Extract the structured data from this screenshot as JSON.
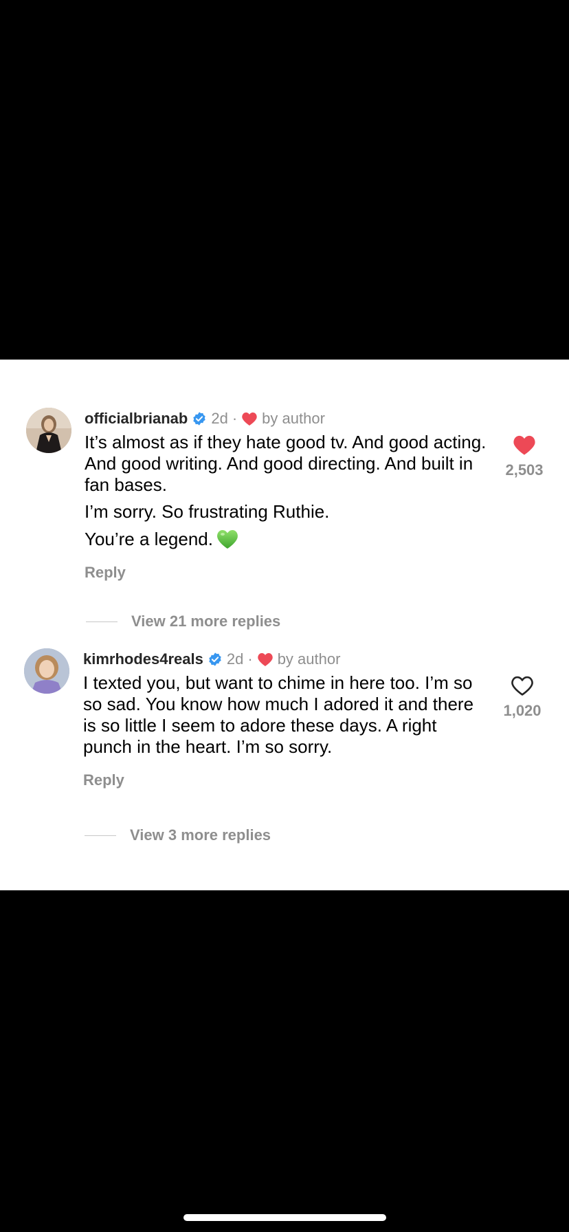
{
  "comments": [
    {
      "username": "officialbrianab",
      "age": "2d",
      "separator": "·",
      "author_like_label": "by author",
      "paragraphs": [
        "It’s almost as if they hate good tv. And good acting. And good writing. And good directing. And built in fan bases.",
        "I’m sorry. So frustrating Ruthie.",
        "You’re a legend."
      ],
      "trailing_emoji": "green-heart",
      "reply_label": "Reply",
      "view_replies_label": "View 21 more replies",
      "like_count": "2,503",
      "liked": true
    },
    {
      "username": "kimrhodes4reals",
      "age": "2d",
      "separator": "·",
      "author_like_label": "by author",
      "paragraphs": [
        "I texted you, but want to chime in here too. I’m so so sad. You know how much I adored it and there is so little I seem to adore these days. A right punch in the heart. I’m so sorry."
      ],
      "reply_label": "Reply",
      "view_replies_label": "View 3 more replies",
      "like_count": "1,020",
      "liked": false
    }
  ],
  "colors": {
    "heart_red": "#ed4956",
    "verified_blue": "#3897f0",
    "secondary_text": "#8e8e8e",
    "green_heart": "#5fc24a"
  }
}
